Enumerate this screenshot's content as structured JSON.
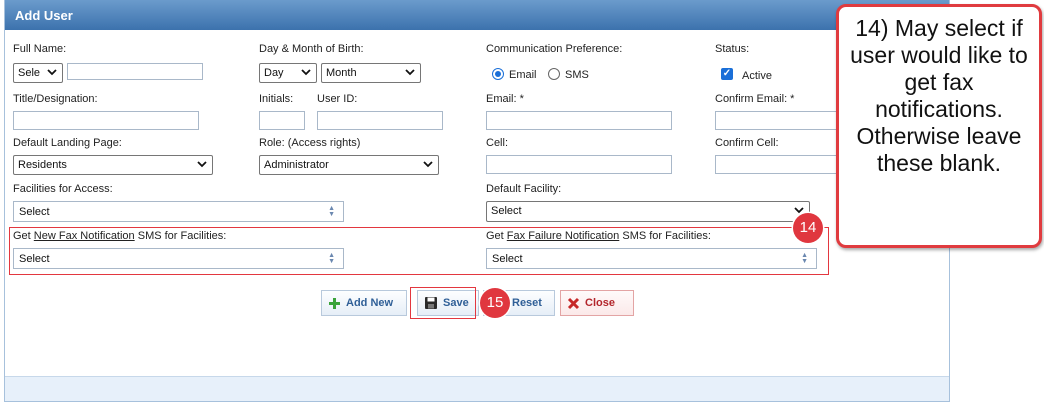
{
  "panel": {
    "title": "Add User"
  },
  "form": {
    "full_name_label": "Full Name:",
    "salutation_value": "Sele",
    "dob_label": "Day & Month of Birth:",
    "day_value": "Day",
    "month_value": "Month",
    "comm_pref_label": "Communication Preference:",
    "comm_email_label": "Email",
    "comm_sms_label": "SMS",
    "status_label": "Status:",
    "status_active_label": "Active",
    "title_label": "Title/Designation:",
    "initials_label": "Initials:",
    "user_id_label": "User ID:",
    "email_label": "Email: *",
    "confirm_email_label": "Confirm Email: *",
    "landing_page_label": "Default Landing Page:",
    "landing_page_value": "Residents",
    "role_label": "Role: (Access rights)",
    "role_value": "Administrator",
    "cell_label": "Cell:",
    "confirm_cell_label": "Confirm Cell:",
    "facilities_label": "Facilities for Access:",
    "facilities_value": "Select",
    "default_facility_label": "Default Facility:",
    "default_facility_value": "Select",
    "fax_new_prefix": "Get ",
    "fax_new_link": "New Fax Notification",
    "fax_new_suffix": " SMS for Facilities:",
    "fax_new_value": "Select",
    "fax_fail_prefix": "Get ",
    "fax_fail_link": "Fax Failure Notification",
    "fax_fail_suffix": " SMS for Facilities:",
    "fax_fail_value": "Select"
  },
  "buttons": {
    "add_new": "Add New",
    "save": "Save",
    "reset": "Reset",
    "close": "Close"
  },
  "annotations": {
    "marker_14": "14",
    "marker_15": "15",
    "callout_text": "14) May select if user would like to get fax notifications. Otherwise leave these blank."
  },
  "colors": {
    "header_blue": "#3c72ad",
    "annotation_red": "#e0373f",
    "accent_blue": "#1a6fd8"
  }
}
